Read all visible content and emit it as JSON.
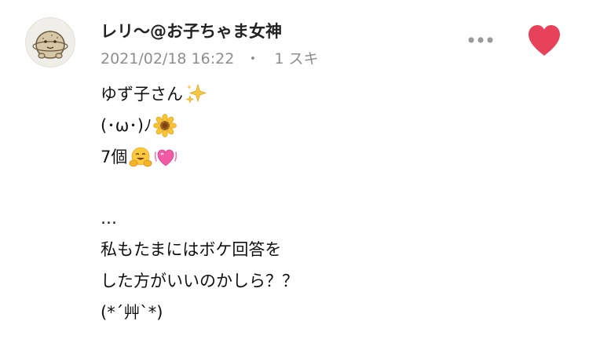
{
  "comment": {
    "username": "レリ〜@お子ちゃま女神",
    "timestamp": "2021/02/18 16:22",
    "separator": "・",
    "likes": "1 スキ",
    "liked": true,
    "accent_color": "#e8415a",
    "icons": {
      "more": "more-dots-icon",
      "like": "heart-icon"
    },
    "body": {
      "line1": "ゆず子さん",
      "line2": "(･ω･)ﾉ",
      "line3": "7個",
      "line4": "…",
      "line5": "私もたまにはボケ回答を",
      "line6": "した方がいいのかしら？？",
      "line7": "(*´艸`*)"
    },
    "emojis": [
      "sparkles-icon",
      "sunflower-icon",
      "hugging-face-icon",
      "beating-heart-icon"
    ]
  }
}
